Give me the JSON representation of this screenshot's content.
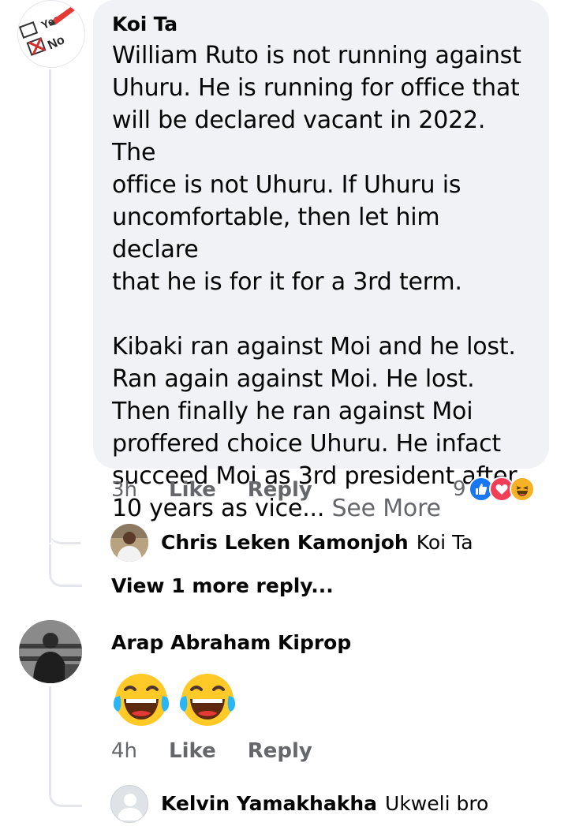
{
  "comment1": {
    "author": "Koi Ta",
    "paragraphs": [
      [
        "William Ruto is not running against",
        "Uhuru. He is running for office that",
        "will be declared vacant in 2022. The",
        "office is not Uhuru. If Uhuru is",
        "uncomfortable, then let him declare",
        "that he is for it for a 3rd term."
      ],
      [
        "Kibaki ran against Moi and he lost.",
        "Ran again against Moi. He lost.",
        "Then finally he ran against Moi",
        "proffered choice Uhuru. He infact",
        "succeed Moi as 3rd president after"
      ]
    ],
    "last_line": "10 years as vice...",
    "see_more": "See More",
    "time": "3h",
    "like_label": "Like",
    "reply_label": "Reply",
    "reaction_count": "9",
    "reactions": [
      "like-icon",
      "love-icon",
      "haha-icon"
    ],
    "avatar_text": {
      "yes": "Yes",
      "no": "No"
    }
  },
  "reply1": {
    "name": "Chris Leken Kamonjoh",
    "text": "Koi Ta"
  },
  "view_more": "View 1 more reply...",
  "comment2": {
    "author": "Arap Abraham Kiprop",
    "emojis": [
      "laughing-crying-emoji",
      "laughing-crying-emoji"
    ],
    "time": "4h",
    "like_label": "Like",
    "reply_label": "Reply"
  },
  "reply2": {
    "name": "Kelvin Yamakhakha",
    "text": "Ukweli bro"
  },
  "colors": {
    "bubble": "#f0f2f5",
    "secondary_text": "#65676b",
    "like_blue": "#1877f2",
    "love_red": "#f33e58",
    "haha_yellow": "#f7b125"
  }
}
